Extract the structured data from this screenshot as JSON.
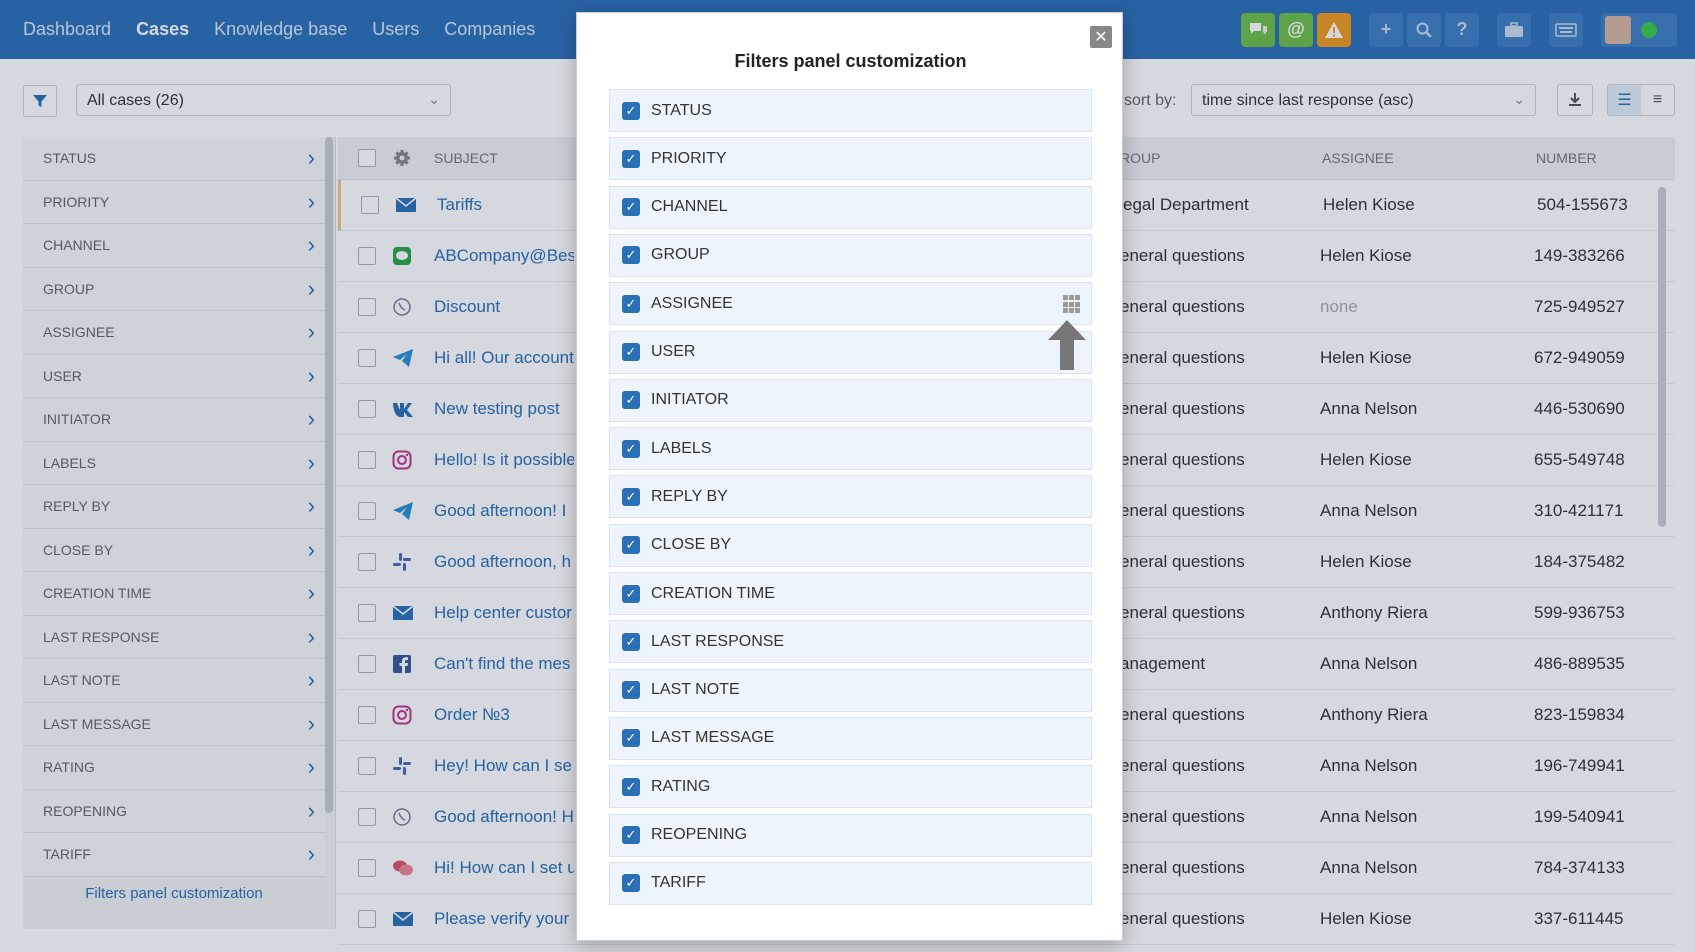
{
  "nav": {
    "items": [
      {
        "label": "Dashboard",
        "active": false
      },
      {
        "label": "Cases",
        "active": true
      },
      {
        "label": "Knowledge base",
        "active": false
      },
      {
        "label": "Users",
        "active": false
      },
      {
        "label": "Companies",
        "active": false
      }
    ],
    "icons": [
      "chat-icon",
      "at-icon",
      "warning-icon",
      "plus-icon",
      "search-icon",
      "help-icon",
      "briefcase-icon",
      "keyboard-icon",
      "avatar",
      "status-online"
    ],
    "colors": {
      "header": "#2b6fb6",
      "green": "#6fbf4a",
      "orange": "#f09a1e"
    }
  },
  "toolbar": {
    "cases_selected": "All cases (26)",
    "sort_label": "sort by:",
    "sort_selected": "time since last response (asc)"
  },
  "filters": {
    "items": [
      "STATUS",
      "PRIORITY",
      "CHANNEL",
      "GROUP",
      "ASSIGNEE",
      "USER",
      "INITIATOR",
      "LABELS",
      "REPLY BY",
      "CLOSE BY",
      "CREATION TIME",
      "LAST RESPONSE",
      "LAST NOTE",
      "LAST MESSAGE",
      "RATING",
      "REOPENING",
      "TARIFF"
    ],
    "customize_link": "Filters panel customization"
  },
  "table": {
    "headers": {
      "subject": "SUBJECT",
      "group": "ROUP",
      "assignee": "ASSIGNEE",
      "number": "NUMBER"
    },
    "rows": [
      {
        "channel": "email-icon",
        "subject": "Tariffs",
        "group": "egal Department",
        "assignee": "Helen Kiose",
        "number": "504-155673"
      },
      {
        "channel": "line-icon",
        "subject": "ABCompany@Bes",
        "group": "eneral questions",
        "assignee": "Helen Kiose",
        "number": "149-383266"
      },
      {
        "channel": "viber-icon",
        "subject": "Discount",
        "group": "eneral questions",
        "assignee": "none",
        "number": "725-949527"
      },
      {
        "channel": "telegram-icon",
        "subject": "Hi all! Our account",
        "group": "eneral questions",
        "assignee": "Helen Kiose",
        "number": "672-949059"
      },
      {
        "channel": "vk-icon",
        "subject": "New testing post",
        "group": "eneral questions",
        "assignee": "Anna Nelson",
        "number": "446-530690"
      },
      {
        "channel": "instagram-icon",
        "subject": "Hello! Is it possible",
        "group": "eneral questions",
        "assignee": "Helen Kiose",
        "number": "655-549748"
      },
      {
        "channel": "telegram-icon",
        "subject": "Good afternoon! I",
        "group": "eneral questions",
        "assignee": "Anna Nelson",
        "number": "310-421171"
      },
      {
        "channel": "slack-icon",
        "subject": "Good afternoon, h",
        "group": "eneral questions",
        "assignee": "Helen Kiose",
        "number": "184-375482"
      },
      {
        "channel": "email-icon",
        "subject": "Help center custor",
        "group": "eneral questions",
        "assignee": "Anthony Riera",
        "number": "599-936753"
      },
      {
        "channel": "facebook-icon",
        "subject": "Can't find the mes",
        "group": "anagement",
        "assignee": "Anna Nelson",
        "number": "486-889535"
      },
      {
        "channel": "instagram-icon",
        "subject": "Order №3",
        "group": "eneral questions",
        "assignee": "Anthony Riera",
        "number": "823-159834"
      },
      {
        "channel": "slack-icon",
        "subject": "Hey! How can I se",
        "group": "eneral questions",
        "assignee": "Anna Nelson",
        "number": "196-749941"
      },
      {
        "channel": "viber-icon",
        "subject": "Good afternoon! H",
        "group": "eneral questions",
        "assignee": "Anna Nelson",
        "number": "199-540941"
      },
      {
        "channel": "chat-icon",
        "subject": "Hi! How can I set u",
        "group": "eneral questions",
        "assignee": "Anna Nelson",
        "number": "784-374133"
      },
      {
        "channel": "email-icon",
        "subject": "Please verify your",
        "group": "eneral questions",
        "assignee": "Helen Kiose",
        "number": "337-611445"
      }
    ]
  },
  "modal": {
    "title": "Filters panel customization",
    "options": [
      "STATUS",
      "PRIORITY",
      "CHANNEL",
      "GROUP",
      "ASSIGNEE",
      "USER",
      "INITIATOR",
      "LABELS",
      "REPLY BY",
      "CLOSE BY",
      "CREATION TIME",
      "LAST RESPONSE",
      "LAST NOTE",
      "LAST MESSAGE",
      "RATING",
      "REOPENING",
      "TARIFF"
    ],
    "checked": [
      true,
      true,
      true,
      true,
      true,
      true,
      true,
      true,
      true,
      true,
      true,
      true,
      true,
      true,
      true,
      true,
      true
    ]
  }
}
